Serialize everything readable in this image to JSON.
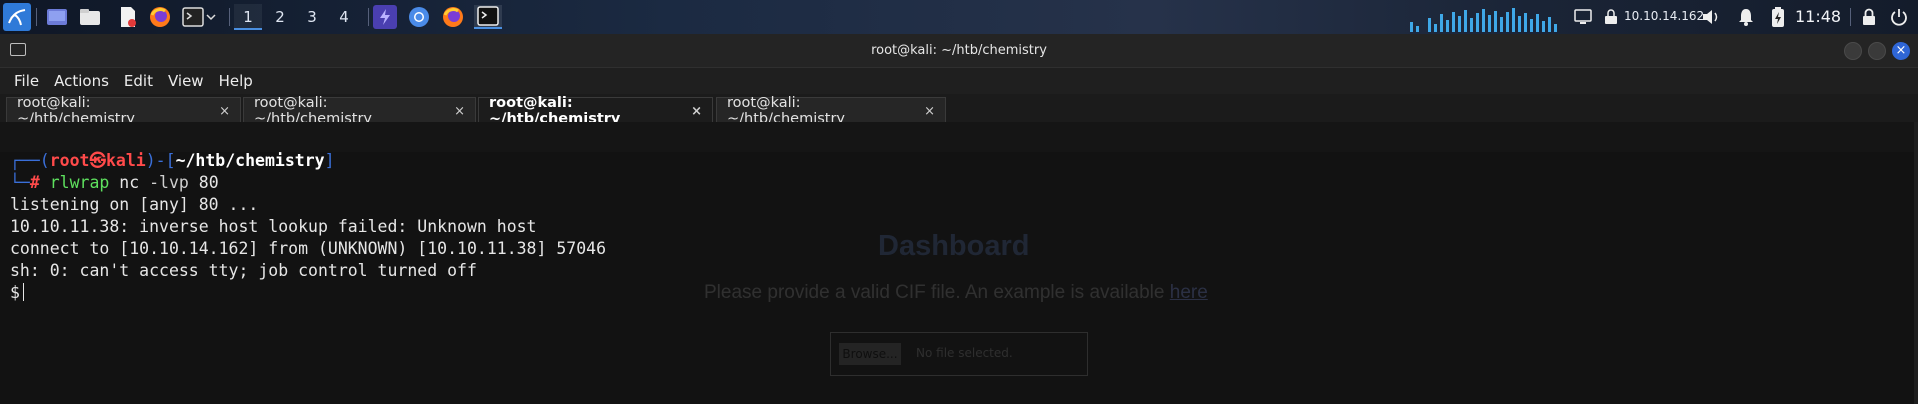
{
  "taskbar": {
    "workspaces": [
      "1",
      "2",
      "3",
      "4"
    ],
    "active_workspace": "1",
    "ip_address": "10.10.14.162",
    "clock": "11:48"
  },
  "window": {
    "title": "root@kali: ~/htb/chemistry",
    "close_glyph": "×"
  },
  "menu": [
    "File",
    "Actions",
    "Edit",
    "View",
    "Help"
  ],
  "tabs": [
    {
      "label": "root@kali: ~/htb/chemistry",
      "close": "×"
    },
    {
      "label": "root@kali: ~/htb/chemistry",
      "close": "×"
    },
    {
      "label": "root@kali: ~/htb/chemistry",
      "close": "×",
      "active": true
    },
    {
      "label": "root@kali: ~/htb/chemistry",
      "close": "×"
    }
  ],
  "terminal": {
    "prompt_user": "root",
    "prompt_at": "㉿",
    "prompt_host": "kali",
    "prompt_path": "~/htb/chemistry",
    "command_name": "rlwrap",
    "command_args": " nc ",
    "command_flag": "-lvp",
    "command_port": " 80",
    "output": [
      "listening on [any] 80 ...",
      "10.10.11.38: inverse host lookup failed: Unknown host",
      "connect to [10.10.14.162] from (UNKNOWN) [10.10.11.38] 57046",
      "sh: 0: can't access tty; job control turned off"
    ],
    "shell_prompt": "$"
  },
  "background_page": {
    "heading": "Dashboard",
    "instruction": "Please provide a valid CIF file. An example is available ",
    "link": "here",
    "browse_button": "Browse...",
    "file_status": "No file selected."
  },
  "colors": {
    "accent": "#2f66d6",
    "prompt_red": "#ff4a4a",
    "prompt_blue": "#3a6fd9",
    "command_green": "#5ee05e"
  }
}
